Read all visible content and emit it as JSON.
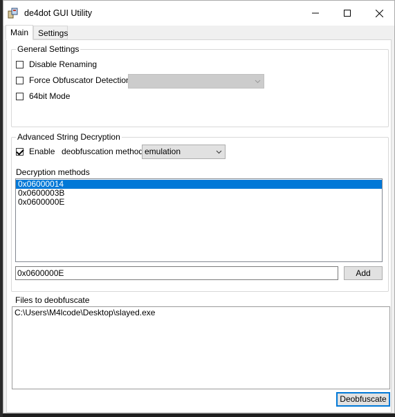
{
  "window": {
    "title": "de4dot GUI Utility",
    "controls": {
      "minimize": "minimize-icon",
      "maximize": "maximize-icon",
      "close": "close-icon"
    }
  },
  "tabs": [
    {
      "label": "Main",
      "active": true
    },
    {
      "label": "Settings",
      "active": false
    }
  ],
  "general_settings": {
    "title": "General Settings",
    "disable_renaming": {
      "label": "Disable Renaming",
      "checked": false
    },
    "force_detection": {
      "label": "Force Obfuscator Detection",
      "checked": false,
      "combo_value": ""
    },
    "bit64_mode": {
      "label": "64bit Mode",
      "checked": false
    }
  },
  "advanced": {
    "title": "Advanced String Decryption",
    "enable": {
      "label": "Enable",
      "checked": true
    },
    "method_label": "deobfuscation method",
    "method_value": "emulation",
    "methods_label": "Decryption methods",
    "methods": [
      "0x06000014",
      "0x0600003B",
      "0x0600000E"
    ],
    "selected_method": "0x06000014",
    "input_value": "0x0600000E",
    "add_label": "Add"
  },
  "files": {
    "label": "Files to deobfuscate",
    "items": [
      "C:\\Users\\M4lcode\\Desktop\\slayed.exe"
    ]
  },
  "deobfuscate_label": "Deobfuscate",
  "colors": {
    "selection": "#0078d7",
    "window_bg": "#f0f0f0",
    "panel_bg": "#ffffff"
  }
}
